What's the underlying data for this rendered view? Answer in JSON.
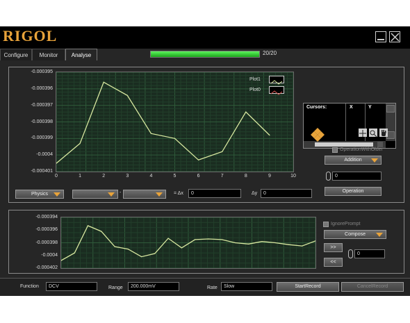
{
  "app": {
    "logo": "RIGOL"
  },
  "window": {
    "minimize_icon": "minimize-icon",
    "close_icon": "close-icon"
  },
  "tabs": [
    {
      "label": "Configure",
      "active": false
    },
    {
      "label": "Monitor",
      "active": false
    },
    {
      "label": "Analyse",
      "active": true
    }
  ],
  "progress": {
    "text": "20/20",
    "fraction": 1.0,
    "color": "#2bd02b"
  },
  "main_graph": {
    "legend": [
      {
        "name": "Plot1",
        "color": "#d8e8a0"
      },
      {
        "name": "Plot0",
        "color": "#d9534f"
      }
    ]
  },
  "cursors": {
    "headers": [
      "Cursors:",
      "X",
      "Y"
    ]
  },
  "analysis": {
    "operation_with_older_label": "OperationWithOlder",
    "operation_select": "Addition",
    "operand_value": "0",
    "operation_button": "Operation"
  },
  "axis_selectors": {
    "first": "Physics",
    "second": "",
    "third": "",
    "minus": "-",
    "dx_label": "= Δx",
    "dx_value": "0",
    "dy_label": "Δy",
    "dy_value": "0"
  },
  "bottom_panel": {
    "ignore_prompt_label": "IgnorePrompt",
    "compose_select": "Compose",
    "next_button": ">>",
    "prev_button": "<<",
    "compose_value": "0"
  },
  "status": {
    "function_label": "Function",
    "function_value": "DCV",
    "range_label": "Range",
    "range_value": "200.000mV",
    "rate_label": "Rate",
    "rate_value": "Slow",
    "start_record": "StartRecord",
    "cancel_record": "CancelRecord"
  },
  "chart_data": [
    {
      "type": "line",
      "x": [
        0,
        1,
        2,
        3,
        4,
        5,
        6,
        7,
        8,
        9
      ],
      "series": [
        {
          "name": "Plot1",
          "color": "#d8e8a0",
          "values": [
            -0.0004005,
            -0.0003993,
            -0.0003956,
            -0.0003964,
            -0.0003987,
            -0.000399,
            -0.0004003,
            -0.0003998,
            -0.0003974,
            -0.0003988
          ]
        }
      ],
      "xlim": [
        0,
        10
      ],
      "ylim": [
        -0.000401,
        -0.000395
      ],
      "xticks": [
        "0",
        "1",
        "2",
        "3",
        "4",
        "5",
        "6",
        "7",
        "8",
        "9",
        "10"
      ],
      "yticks": [
        "-0.000395",
        "-0.000396",
        "-0.000397",
        "-0.000398",
        "-0.000399",
        "-0.0004",
        "-0.000401"
      ],
      "grid": true
    },
    {
      "type": "line",
      "x": [
        0,
        1,
        2,
        3,
        4,
        5,
        6,
        7,
        8,
        9,
        10,
        11,
        12,
        13,
        14,
        15,
        16,
        17,
        18,
        19
      ],
      "series": [
        {
          "name": "",
          "color": "#d8e8a0",
          "values": [
            -0.0004008,
            -0.0003996,
            -0.0003953,
            -0.0003962,
            -0.0003986,
            -0.000399,
            -0.0004002,
            -0.0003997,
            -0.0003973,
            -0.0003988,
            -0.0003975,
            -0.0003974,
            -0.0003975,
            -0.000398,
            -0.0003982,
            -0.0003978,
            -0.000398,
            -0.0003983,
            -0.0003985,
            -0.0003977
          ]
        }
      ],
      "ylim": [
        -0.000402,
        -0.000394
      ],
      "yticks": [
        "-0.000394",
        "-0.000396",
        "-0.000398",
        "-0.0004",
        "-0.000402"
      ],
      "grid": true
    }
  ]
}
